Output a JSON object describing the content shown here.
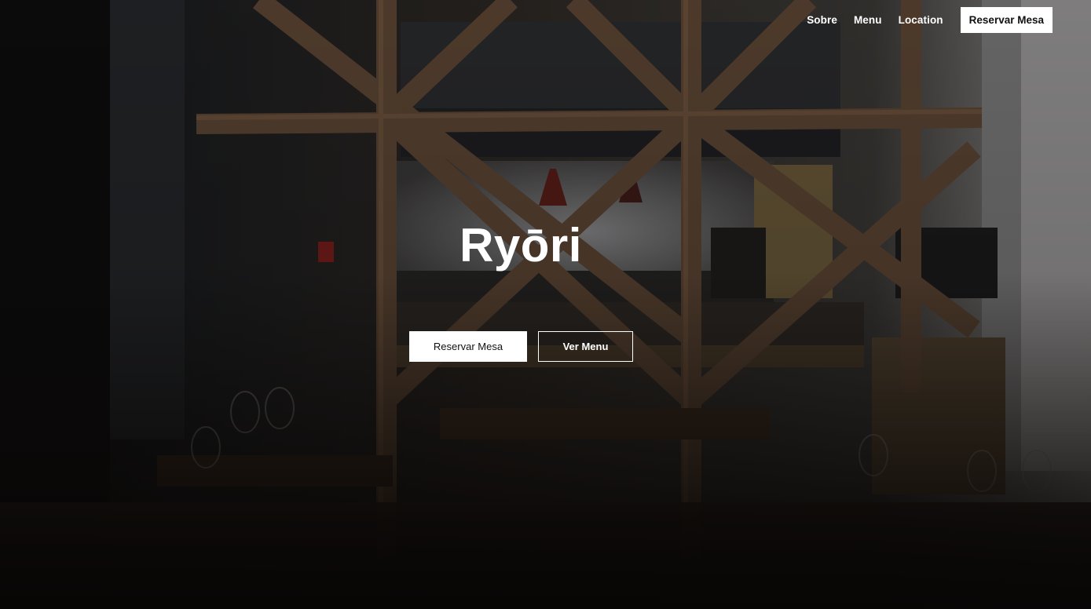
{
  "nav": {
    "links": [
      {
        "label": "Sobre"
      },
      {
        "label": "Menu"
      },
      {
        "label": "Location"
      }
    ],
    "cta_label": "Reservar Mesa"
  },
  "hero": {
    "title": "Ryōri",
    "primary_button": "Reservar Mesa",
    "secondary_button": "Ver Menu"
  },
  "colors": {
    "text": "#ffffff",
    "button_bg": "#ffffff",
    "button_text": "#111111"
  },
  "icons": {
    "background": "restaurant-interior-photo"
  }
}
